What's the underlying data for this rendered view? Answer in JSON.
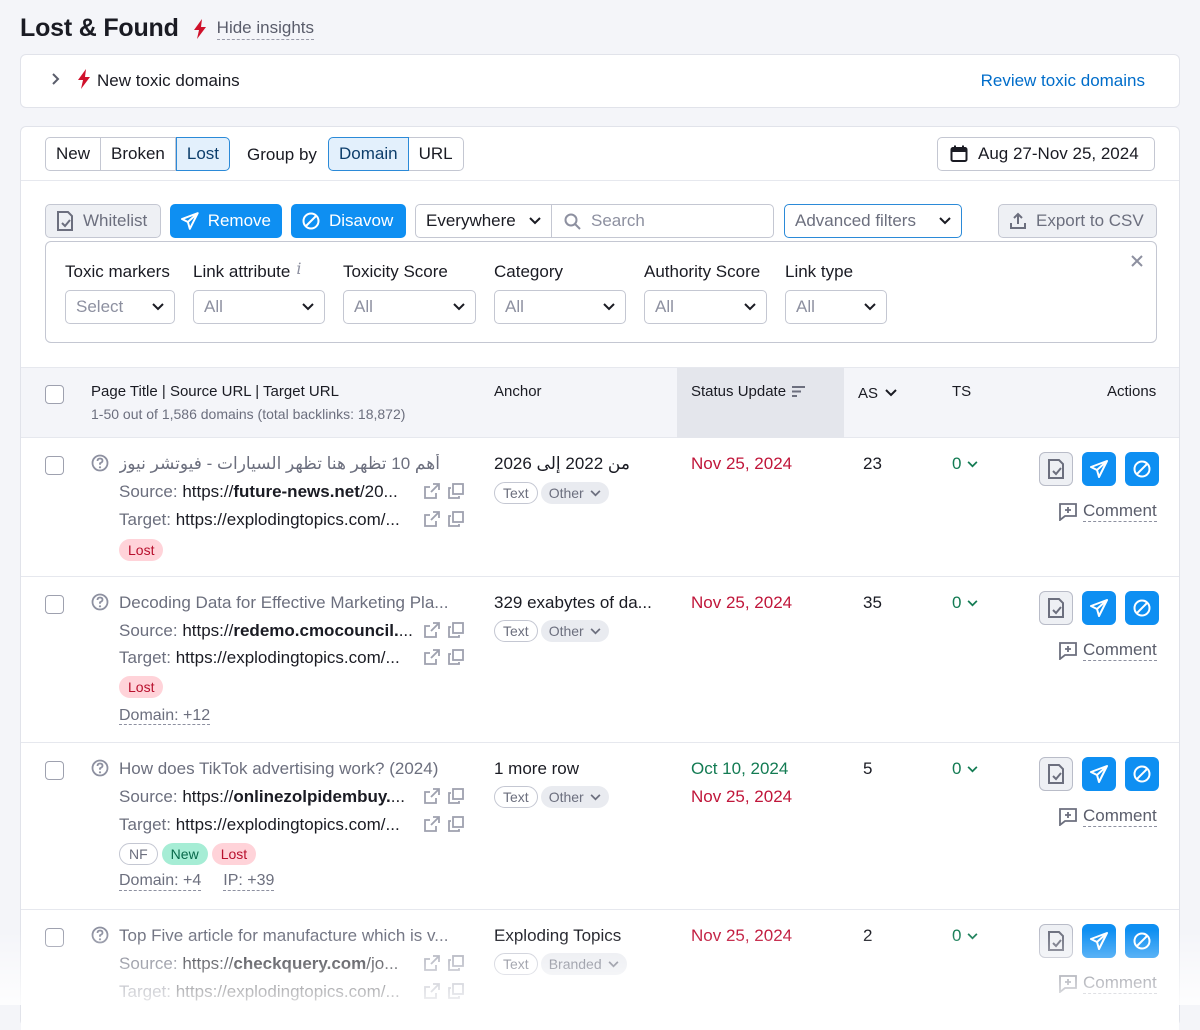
{
  "page": {
    "title": "Lost & Found",
    "hide_insights": "Hide insights"
  },
  "insight": {
    "label": "New toxic domains",
    "link": "Review toxic domains"
  },
  "type_tabs": [
    "New",
    "Broken",
    "Lost"
  ],
  "type_active": "Lost",
  "group_by": {
    "label": "Group by",
    "options": [
      "Domain",
      "URL"
    ],
    "active": "Domain"
  },
  "date_range": "Aug 27-Nov 25, 2024",
  "toolbar": {
    "whitelist": "Whitelist",
    "remove": "Remove",
    "disavow": "Disavow",
    "scope": "Everywhere",
    "search_placeholder": "Search",
    "advanced": "Advanced filters",
    "export": "Export to CSV"
  },
  "filters": [
    {
      "label": "Toxic markers",
      "value": "Select"
    },
    {
      "label": "Link attribute",
      "value": "All",
      "info": "i"
    },
    {
      "label": "Toxicity Score",
      "value": "All"
    },
    {
      "label": "Category",
      "value": "All"
    },
    {
      "label": "Authority Score",
      "value": "All"
    },
    {
      "label": "Link type",
      "value": "All"
    }
  ],
  "table": {
    "col_page": "Page Title | Source URL | Target URL",
    "col_page_sub": "1-50 out of 1,586 domains (total backlinks: 18,872)",
    "col_anchor": "Anchor",
    "col_status": "Status Update",
    "col_as": "AS",
    "col_ts": "TS",
    "col_actions": "Actions",
    "comment_label": "Comment",
    "source_label": "Source:",
    "target_label": "Target:",
    "rows": [
      {
        "title": "أهم 10 تظهر هنا تظهر السيارات - فيوتشر نيوز",
        "source_pre": "https://",
        "source_bold": "future-news.net",
        "source_post": "/20...",
        "target": "https://explodingtopics.com/...",
        "badges": [
          "Lost"
        ],
        "anchor": "من 2022 إلى 2026",
        "anchor_type": "Text",
        "anchor_cat": "Other",
        "dates": [
          "Nov 25, 2024"
        ],
        "as": "23",
        "ts": "0"
      },
      {
        "title": "Decoding Data for Effective Marketing Pla...",
        "source_pre": "https://",
        "source_bold": "redemo.cmocouncil.",
        "source_post": "...",
        "target": "https://explodingtopics.com/...",
        "badges": [
          "Lost"
        ],
        "extra1": "Domain: +12",
        "anchor": "329 exabytes of da...",
        "anchor_type": "Text",
        "anchor_cat": "Other",
        "dates": [
          "Nov 25, 2024"
        ],
        "as": "35",
        "ts": "0"
      },
      {
        "title": "How does TikTok advertising work? (2024)",
        "source_pre": "https://",
        "source_bold": "onlinezolpidembuy.",
        "source_post": "...",
        "target": "https://explodingtopics.com/...",
        "badges": [
          "NF",
          "New",
          "Lost"
        ],
        "extra1": "Domain: +4",
        "extra2": "IP: +39",
        "anchor": "1 more row",
        "anchor_type": "Text",
        "anchor_cat": "Other",
        "dates": [
          "Oct 10, 2024",
          "Nov 25, 2024"
        ],
        "as": "5",
        "ts": "0"
      },
      {
        "title": "Top Five article for manufacture which is v...",
        "source_pre": "https://",
        "source_bold": "checkquery.com",
        "source_post": "/jo...",
        "target": "https://explodingtopics.com/...",
        "anchor": "Exploding Topics",
        "anchor_type": "Text",
        "anchor_cat": "Branded",
        "dates": [
          "Nov 25, 2024"
        ],
        "as": "2",
        "ts": "0"
      }
    ]
  },
  "colors": {
    "accent": "#0e8ff2",
    "lost": "#c0163a",
    "new": "#137b53",
    "link": "#006dca"
  }
}
